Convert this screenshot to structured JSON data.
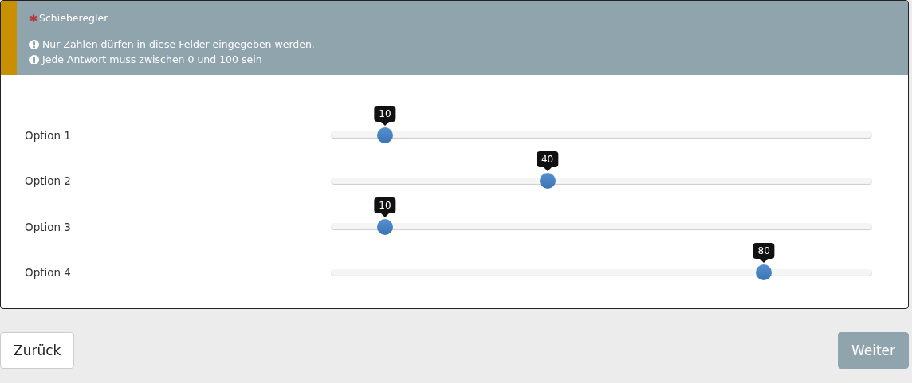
{
  "question": {
    "title": "Schieberegler",
    "required": true,
    "tips": [
      "Nur Zahlen dürfen in diese Felder eingegeben werden.",
      "Jede Antwort muss zwischen 0 und 100 sein"
    ]
  },
  "sliders": [
    {
      "label": "Option 1",
      "value": "10",
      "level": 0.1
    },
    {
      "label": "Option 2",
      "value": "40",
      "level": 0.4
    },
    {
      "label": "Option 3",
      "value": "10",
      "level": 0.1
    },
    {
      "label": "Option 4",
      "value": "80",
      "level": 0.8
    }
  ],
  "buttons": {
    "back": "Zurück",
    "next": "Weiter"
  }
}
